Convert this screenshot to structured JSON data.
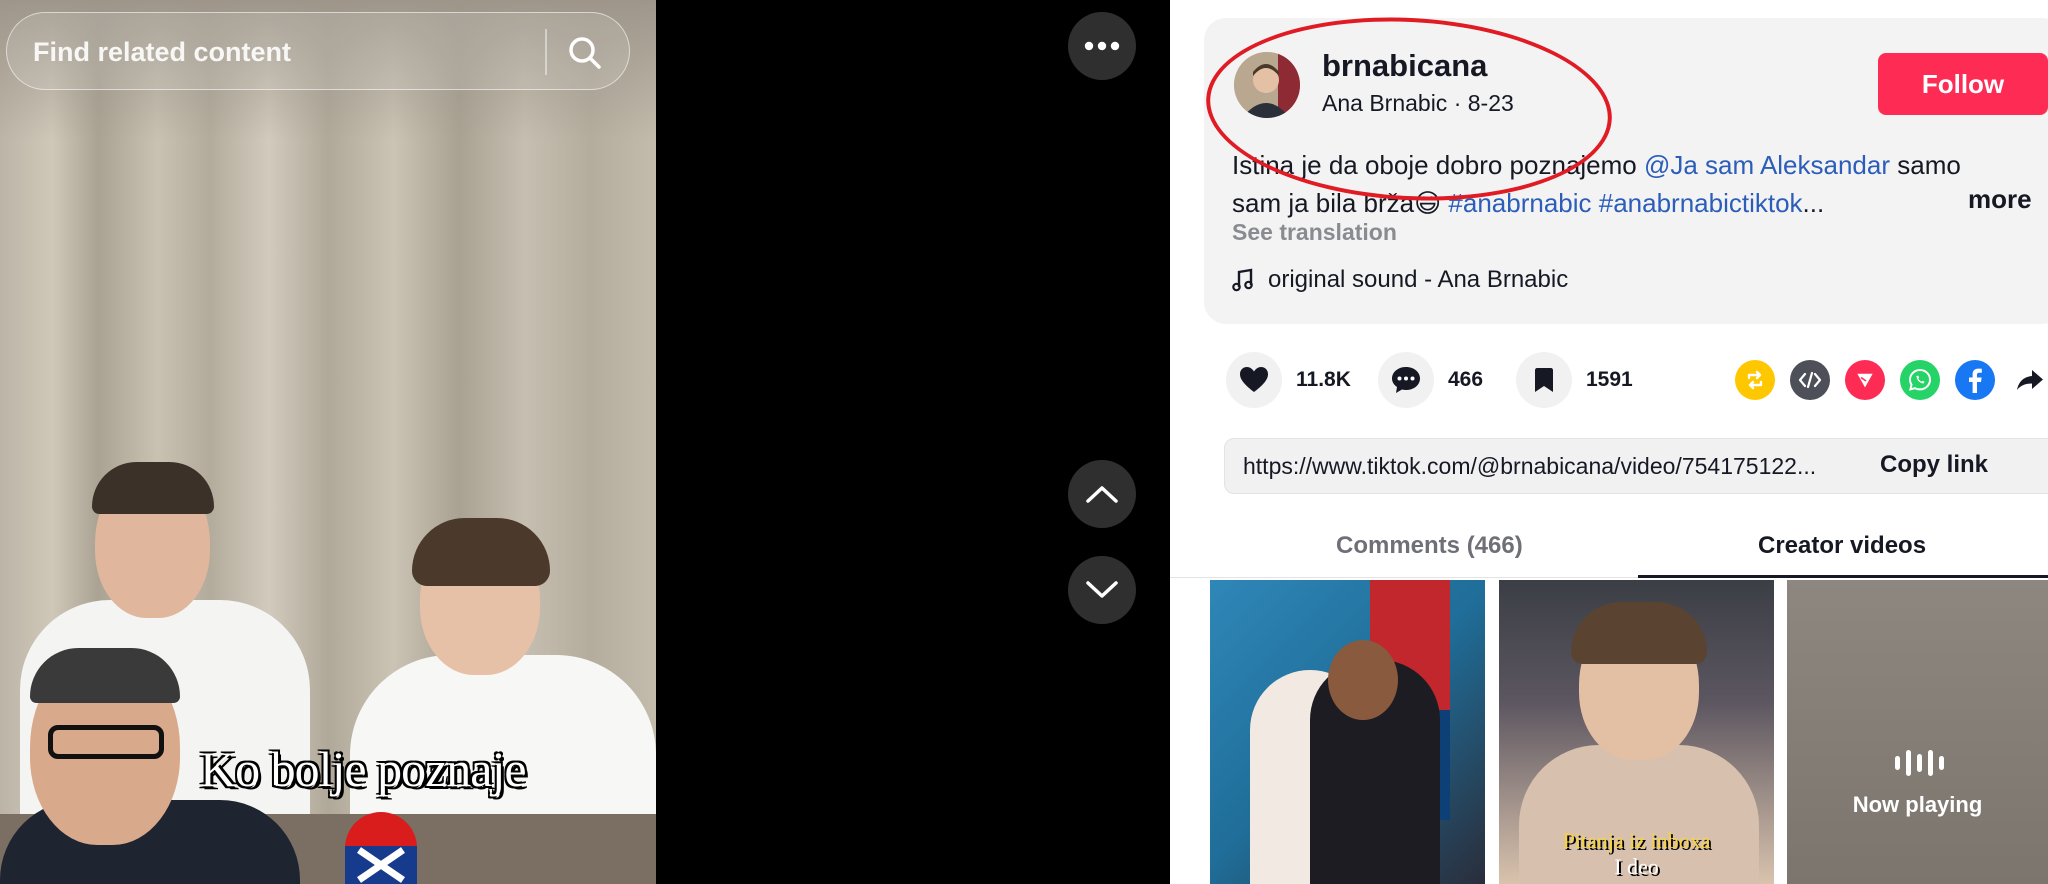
{
  "search": {
    "placeholder": "Find related content"
  },
  "video": {
    "subtitle": "Ko bolje poznaje"
  },
  "profile": {
    "username": "brnabicana",
    "display_name": "Ana Brnabic",
    "separator": " · ",
    "date": "8-23",
    "follow_label": "Follow"
  },
  "caption": {
    "line1_text": "Istina je da oboje dobro poznajemo ",
    "line1_mention": "@Ja sam Aleksandar",
    "line1_end": " samo",
    "line2_text": "sam ja bila brža",
    "line2_emoji": "😄",
    "line2_tags": " #anabrnabic #anabrnabictiktok",
    "line2_ellipsis": "...",
    "more_label": "more",
    "see_translation": "See translation"
  },
  "sound": {
    "label": "original sound - Ana Brnabic"
  },
  "stats": {
    "likes": "11.8K",
    "comments": "466",
    "saves": "1591"
  },
  "link": {
    "url": "https://www.tiktok.com/@brnabicana/video/754175122...",
    "copy_label": "Copy link"
  },
  "tabs": {
    "comments": "Comments (466)",
    "creator": "Creator videos"
  },
  "thumbnails": {
    "t2_caption_line1": "Pitanja iz inboxa",
    "t2_caption_line2": "I deo",
    "now_playing": "Now playing"
  },
  "colors": {
    "accent": "#fe2c55",
    "link": "#2b5db9",
    "annotation": "#e01b24"
  }
}
